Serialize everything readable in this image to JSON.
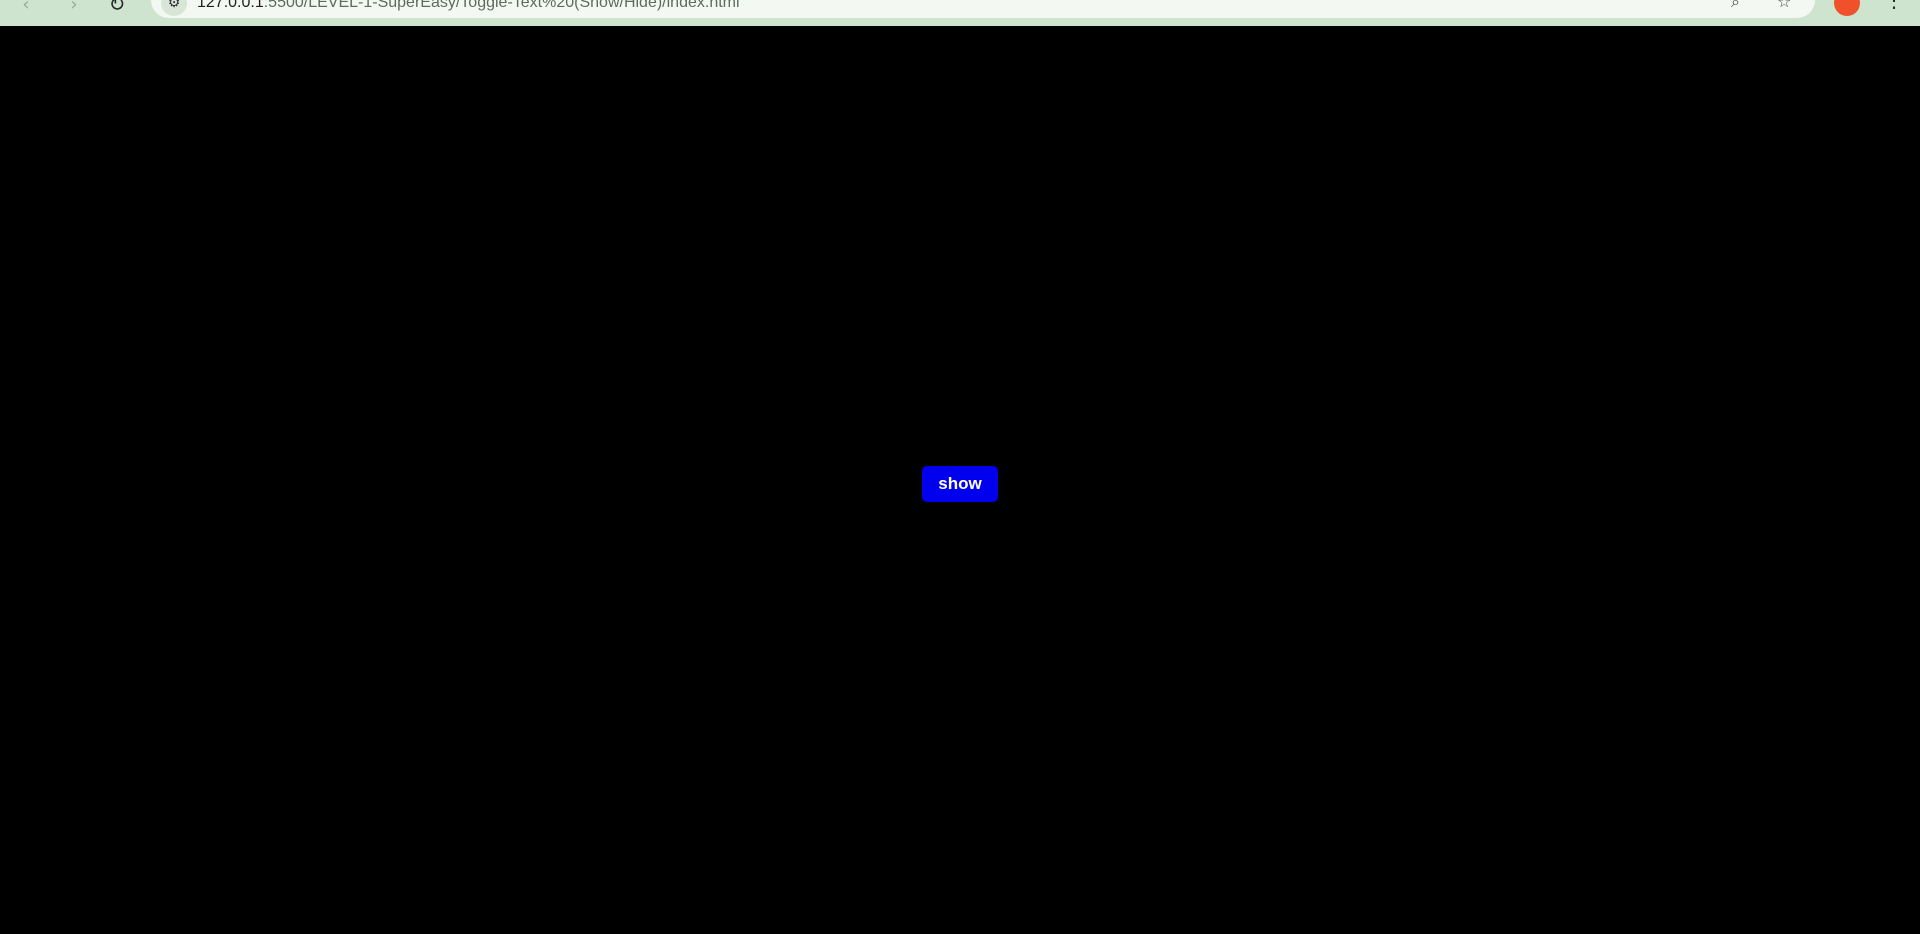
{
  "browser": {
    "url_host": "127.0.0.1",
    "url_path": ":5500/LEVEL-1-SuperEasy/Toggle-Text%20(Show/Hide)/index.html",
    "icons": {
      "back": "back-arrow-icon",
      "forward": "forward-arrow-icon",
      "reload": "reload-icon",
      "site_info": "site-info-icon",
      "zoom": "zoom-icon",
      "bookmark": "star-icon",
      "profile": "profile-avatar",
      "menu": "kebab-menu-icon"
    },
    "colors": {
      "chrome_bg": "#cfe4cf",
      "address_bg": "#f3f8f3",
      "profile_avatar": "#f0512a"
    }
  },
  "page": {
    "background": "#000000",
    "toggle_button": {
      "label": "show",
      "color": "#0000ee"
    }
  }
}
